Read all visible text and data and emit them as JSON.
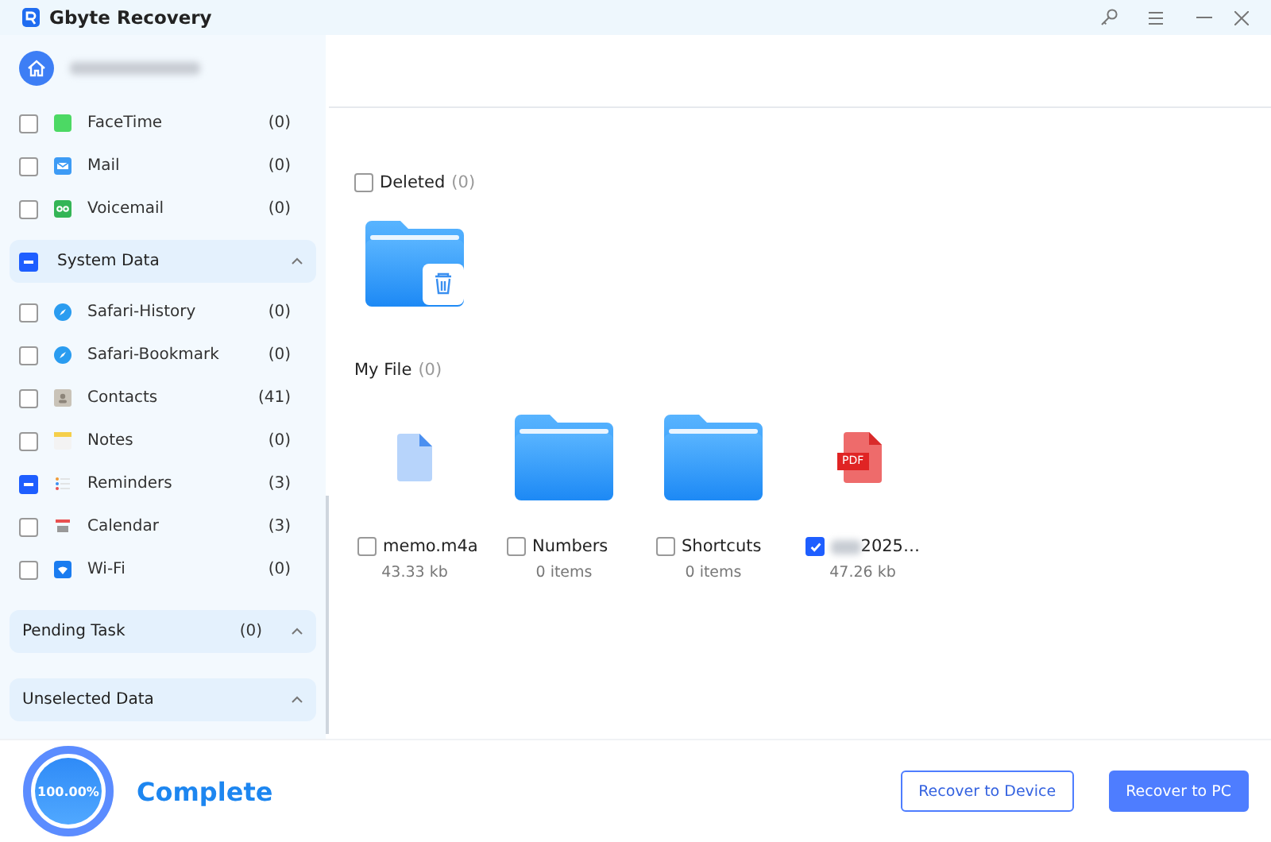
{
  "window": {
    "title": "Gbyte Recovery"
  },
  "sidebar": {
    "items": [
      {
        "label": "FaceTime",
        "count": "(0)",
        "checked": false,
        "kind": "facetime"
      },
      {
        "label": "Mail",
        "count": "(0)",
        "checked": false,
        "kind": "mail"
      },
      {
        "label": "Voicemail",
        "count": "(0)",
        "checked": false,
        "kind": "voicemail"
      }
    ],
    "group": {
      "label": "System Data",
      "checked": true,
      "indeterminate": true,
      "items": [
        {
          "label": "Safari-History",
          "count": "(0)",
          "checked": false,
          "kind": "safari"
        },
        {
          "label": "Safari-Bookmark",
          "count": "(0)",
          "checked": false,
          "kind": "safari"
        },
        {
          "label": "Contacts",
          "count": "(41)",
          "checked": false,
          "kind": "contacts"
        },
        {
          "label": "Notes",
          "count": "(0)",
          "checked": false,
          "kind": "notes"
        },
        {
          "label": "Reminders",
          "count": "(3)",
          "checked": true,
          "indeterminate": true,
          "kind": "reminders"
        },
        {
          "label": "Calendar",
          "count": "(3)",
          "checked": false,
          "kind": "calendar"
        },
        {
          "label": "Wi-Fi",
          "count": "(0)",
          "checked": false,
          "kind": "wifi"
        }
      ]
    },
    "panels": [
      {
        "label": "Pending Task",
        "count": "(0)"
      },
      {
        "label": "Unselected Data"
      }
    ]
  },
  "sections": [
    {
      "title": "Deleted",
      "count": "(0)",
      "checked": false,
      "files": [
        {
          "kind": "trash-folder"
        }
      ]
    },
    {
      "title": "My File",
      "count": "(0)",
      "files": [
        {
          "kind": "file",
          "name": "memo.m4a",
          "info": "43.33 kb",
          "checked": false
        },
        {
          "kind": "folder",
          "name": "Numbers",
          "info": "0 items",
          "checked": false
        },
        {
          "kind": "folder",
          "name": "Shortcuts",
          "info": "0 items",
          "checked": false
        },
        {
          "kind": "pdf",
          "badge": "PDF",
          "name": "2025…",
          "redacted": true,
          "info": "47.26 kb",
          "checked": true
        }
      ]
    }
  ],
  "progress": {
    "label": "100.00%",
    "level": 1,
    "status": "Complete"
  },
  "buttons": [
    {
      "label": "Recover to Device",
      "primary": false
    },
    {
      "label": "Recover to PC",
      "primary": true
    }
  ]
}
